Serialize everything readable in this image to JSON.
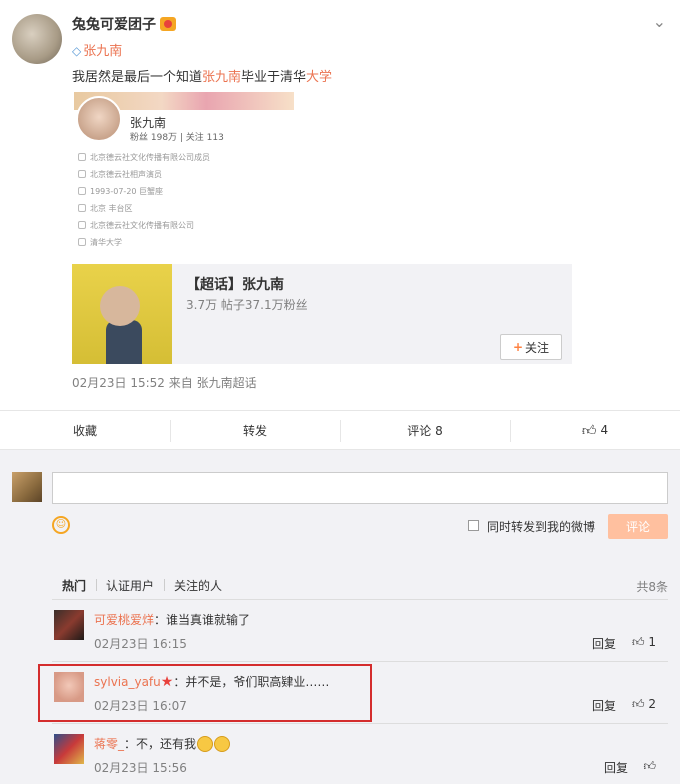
{
  "post": {
    "author": "兔兔可爱团子",
    "topic": "张九南",
    "text_prefix": "我居然是最后一个知道",
    "text_highlight1": "张九南",
    "text_middle": "毕业于清华",
    "text_highlight2": "大学",
    "meta": "02月23日 15:52  来自 张九南超话"
  },
  "profile_card": {
    "name": "张九南",
    "stats": "粉丝 198万 | 关注 113",
    "rows": [
      "北京德云社文化传播有限公司成员",
      "北京德云社相声演员",
      "1993-07-20 巨蟹座",
      "北京 丰台区",
      "北京德云社文化传播有限公司",
      "清华大学"
    ]
  },
  "super_topic": {
    "title": "【超话】张九南",
    "subtitle": "3.7万 帖子37.1万粉丝",
    "follow_label": "关注"
  },
  "actions": {
    "favorite": "收藏",
    "forward": "转发",
    "comment": "评论 8",
    "like": "4"
  },
  "composer": {
    "forward_label": "同时转发到我的微博",
    "submit_label": "评论"
  },
  "comment_tabs": [
    "热门",
    "认证用户",
    "关注的人"
  ],
  "comment_total": "共8条",
  "comments": [
    {
      "user": "可爱桃爱烊",
      "text": "：谁当真谁就输了",
      "time": "02月23日 16:15",
      "reply": "回复",
      "likes": "1"
    },
    {
      "user": "sylvia_yafu",
      "text": "：并不是，爷们职高肄业……",
      "time": "02月23日 16:07",
      "reply": "回复",
      "likes": "2"
    },
    {
      "user": "蒋零_",
      "text": "：不，还有我",
      "time": "02月23日 15:56",
      "reply": "回复",
      "likes": ""
    }
  ]
}
